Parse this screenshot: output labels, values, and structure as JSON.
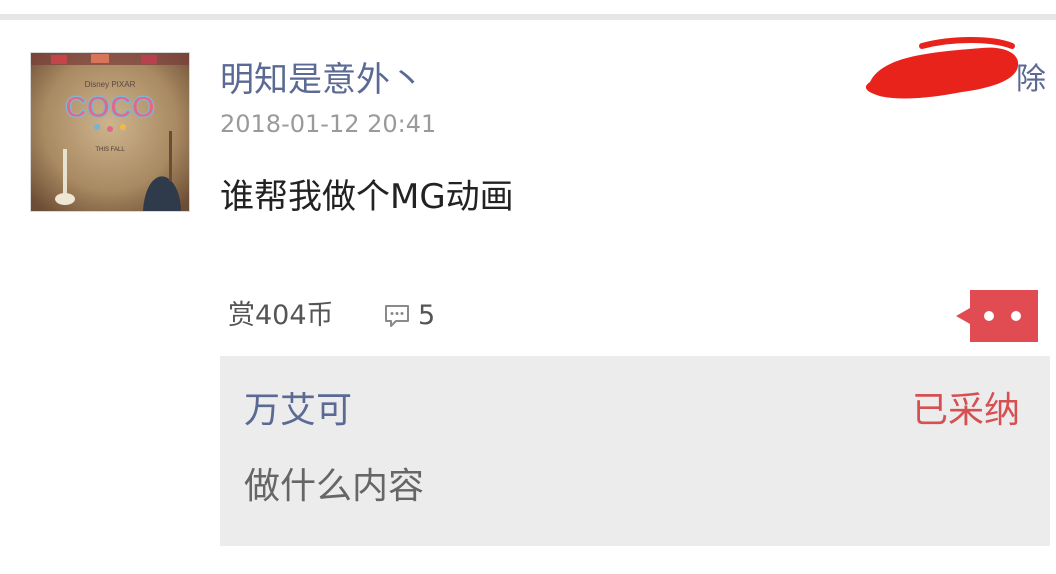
{
  "post": {
    "username": "明知是意外丶",
    "timestamp": "2018-01-12 20:41",
    "text": "谁帮我做个MG动画",
    "delete_label": "除",
    "avatar": {
      "brand": "Disney PIXAR",
      "title": "COCO",
      "subtitle": "THIS FALL"
    }
  },
  "stats": {
    "reward": "赏404币",
    "comment_icon": "comment-bubble-icon",
    "comment_count": "5"
  },
  "reply": {
    "author": "万艾可",
    "status": "已采纳",
    "text": "做什么内容"
  },
  "colors": {
    "link": "#5b6a94",
    "accent_red": "#d65052",
    "redaction": "#e8231c",
    "reply_bg": "#ececec"
  }
}
